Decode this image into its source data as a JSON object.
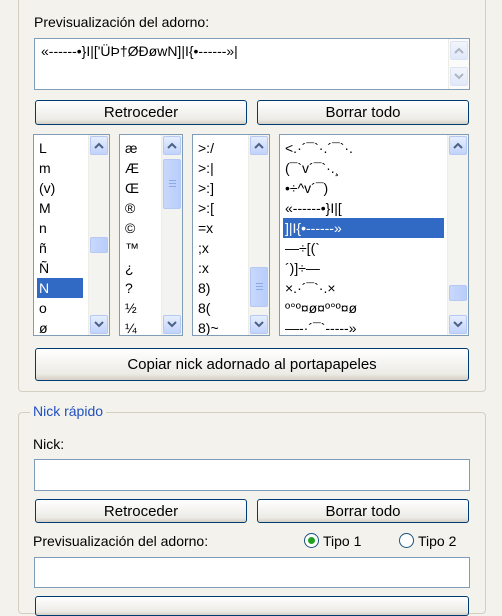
{
  "preview": {
    "label": "Previsualización del adorno:",
    "text": "«------•}I|['ÜÞ†ØÐøwN]|I{•------»|"
  },
  "buttons": {
    "back": "Retroceder",
    "clear_all": "Borrar todo",
    "copy": "Copiar nick adornado al portapapeles"
  },
  "lists": {
    "list1": [
      "L",
      "m",
      "(v)",
      "M",
      "n",
      "ñ",
      "Ñ",
      "N",
      "o",
      "ø"
    ],
    "list1_selected": "N",
    "list2": [
      "æ",
      "Æ",
      "Œ",
      "®",
      "©",
      "™",
      "¿",
      "?",
      "½",
      "¼"
    ],
    "list3": [
      ">:/",
      ">:|",
      ">:]",
      ">:[",
      "=x",
      ";x",
      ":x",
      "8)",
      "8(",
      "8)~"
    ],
    "list4": [
      "<.·´¯`·.´¯`·.",
      "(¯`v´¯`·.¸",
      "•÷^v´¯)",
      "«------•}I|[",
      "]|I{•------»",
      "—÷[(`",
      "´)]÷—",
      "×.·´¯`·.×",
      "º°º¤ø¤º°º¤ø",
      "—-·´¯`-----»"
    ],
    "list4_selected": "]|I{•------»"
  },
  "quick": {
    "title": "Nick rápido",
    "nick_label": "Nick:",
    "nick_value": "",
    "back": "Retroceder",
    "clear_all": "Borrar todo",
    "preview_label": "Previsualización del adorno:",
    "radio1": "Tipo 1",
    "radio2": "Tipo 2",
    "selected": "Tipo 1",
    "preview_value": ""
  }
}
